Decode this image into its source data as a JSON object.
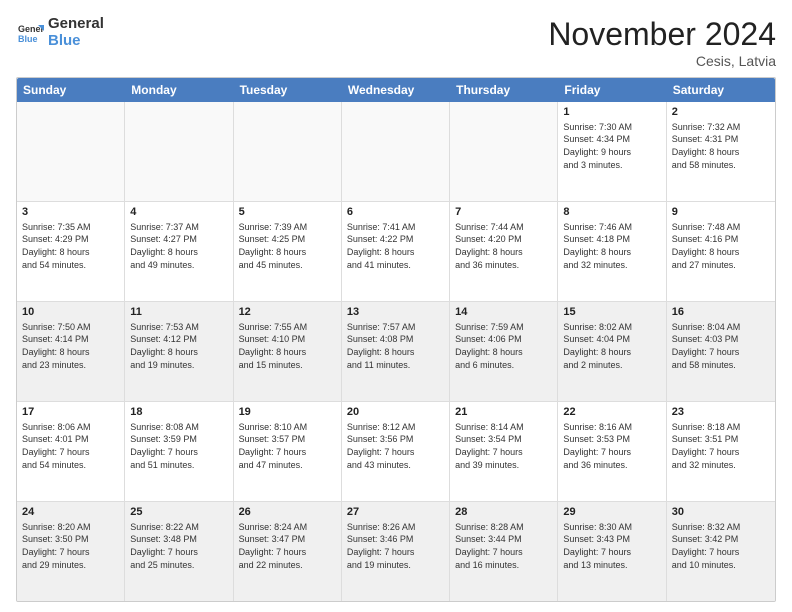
{
  "logo": {
    "line1": "General",
    "line2": "Blue"
  },
  "title": "November 2024",
  "location": "Cesis, Latvia",
  "days_of_week": [
    "Sunday",
    "Monday",
    "Tuesday",
    "Wednesday",
    "Thursday",
    "Friday",
    "Saturday"
  ],
  "weeks": [
    [
      {
        "day": "",
        "info": "",
        "shaded": true
      },
      {
        "day": "",
        "info": "",
        "shaded": true
      },
      {
        "day": "",
        "info": "",
        "shaded": true
      },
      {
        "day": "",
        "info": "",
        "shaded": true
      },
      {
        "day": "",
        "info": "",
        "shaded": true
      },
      {
        "day": "1",
        "info": "Sunrise: 7:30 AM\nSunset: 4:34 PM\nDaylight: 9 hours\nand 3 minutes.",
        "shaded": false
      },
      {
        "day": "2",
        "info": "Sunrise: 7:32 AM\nSunset: 4:31 PM\nDaylight: 8 hours\nand 58 minutes.",
        "shaded": false
      }
    ],
    [
      {
        "day": "3",
        "info": "Sunrise: 7:35 AM\nSunset: 4:29 PM\nDaylight: 8 hours\nand 54 minutes.",
        "shaded": false
      },
      {
        "day": "4",
        "info": "Sunrise: 7:37 AM\nSunset: 4:27 PM\nDaylight: 8 hours\nand 49 minutes.",
        "shaded": false
      },
      {
        "day": "5",
        "info": "Sunrise: 7:39 AM\nSunset: 4:25 PM\nDaylight: 8 hours\nand 45 minutes.",
        "shaded": false
      },
      {
        "day": "6",
        "info": "Sunrise: 7:41 AM\nSunset: 4:22 PM\nDaylight: 8 hours\nand 41 minutes.",
        "shaded": false
      },
      {
        "day": "7",
        "info": "Sunrise: 7:44 AM\nSunset: 4:20 PM\nDaylight: 8 hours\nand 36 minutes.",
        "shaded": false
      },
      {
        "day": "8",
        "info": "Sunrise: 7:46 AM\nSunset: 4:18 PM\nDaylight: 8 hours\nand 32 minutes.",
        "shaded": false
      },
      {
        "day": "9",
        "info": "Sunrise: 7:48 AM\nSunset: 4:16 PM\nDaylight: 8 hours\nand 27 minutes.",
        "shaded": false
      }
    ],
    [
      {
        "day": "10",
        "info": "Sunrise: 7:50 AM\nSunset: 4:14 PM\nDaylight: 8 hours\nand 23 minutes.",
        "shaded": true
      },
      {
        "day": "11",
        "info": "Sunrise: 7:53 AM\nSunset: 4:12 PM\nDaylight: 8 hours\nand 19 minutes.",
        "shaded": true
      },
      {
        "day": "12",
        "info": "Sunrise: 7:55 AM\nSunset: 4:10 PM\nDaylight: 8 hours\nand 15 minutes.",
        "shaded": true
      },
      {
        "day": "13",
        "info": "Sunrise: 7:57 AM\nSunset: 4:08 PM\nDaylight: 8 hours\nand 11 minutes.",
        "shaded": true
      },
      {
        "day": "14",
        "info": "Sunrise: 7:59 AM\nSunset: 4:06 PM\nDaylight: 8 hours\nand 6 minutes.",
        "shaded": true
      },
      {
        "day": "15",
        "info": "Sunrise: 8:02 AM\nSunset: 4:04 PM\nDaylight: 8 hours\nand 2 minutes.",
        "shaded": true
      },
      {
        "day": "16",
        "info": "Sunrise: 8:04 AM\nSunset: 4:03 PM\nDaylight: 7 hours\nand 58 minutes.",
        "shaded": true
      }
    ],
    [
      {
        "day": "17",
        "info": "Sunrise: 8:06 AM\nSunset: 4:01 PM\nDaylight: 7 hours\nand 54 minutes.",
        "shaded": false
      },
      {
        "day": "18",
        "info": "Sunrise: 8:08 AM\nSunset: 3:59 PM\nDaylight: 7 hours\nand 51 minutes.",
        "shaded": false
      },
      {
        "day": "19",
        "info": "Sunrise: 8:10 AM\nSunset: 3:57 PM\nDaylight: 7 hours\nand 47 minutes.",
        "shaded": false
      },
      {
        "day": "20",
        "info": "Sunrise: 8:12 AM\nSunset: 3:56 PM\nDaylight: 7 hours\nand 43 minutes.",
        "shaded": false
      },
      {
        "day": "21",
        "info": "Sunrise: 8:14 AM\nSunset: 3:54 PM\nDaylight: 7 hours\nand 39 minutes.",
        "shaded": false
      },
      {
        "day": "22",
        "info": "Sunrise: 8:16 AM\nSunset: 3:53 PM\nDaylight: 7 hours\nand 36 minutes.",
        "shaded": false
      },
      {
        "day": "23",
        "info": "Sunrise: 8:18 AM\nSunset: 3:51 PM\nDaylight: 7 hours\nand 32 minutes.",
        "shaded": false
      }
    ],
    [
      {
        "day": "24",
        "info": "Sunrise: 8:20 AM\nSunset: 3:50 PM\nDaylight: 7 hours\nand 29 minutes.",
        "shaded": true
      },
      {
        "day": "25",
        "info": "Sunrise: 8:22 AM\nSunset: 3:48 PM\nDaylight: 7 hours\nand 25 minutes.",
        "shaded": true
      },
      {
        "day": "26",
        "info": "Sunrise: 8:24 AM\nSunset: 3:47 PM\nDaylight: 7 hours\nand 22 minutes.",
        "shaded": true
      },
      {
        "day": "27",
        "info": "Sunrise: 8:26 AM\nSunset: 3:46 PM\nDaylight: 7 hours\nand 19 minutes.",
        "shaded": true
      },
      {
        "day": "28",
        "info": "Sunrise: 8:28 AM\nSunset: 3:44 PM\nDaylight: 7 hours\nand 16 minutes.",
        "shaded": true
      },
      {
        "day": "29",
        "info": "Sunrise: 8:30 AM\nSunset: 3:43 PM\nDaylight: 7 hours\nand 13 minutes.",
        "shaded": true
      },
      {
        "day": "30",
        "info": "Sunrise: 8:32 AM\nSunset: 3:42 PM\nDaylight: 7 hours\nand 10 minutes.",
        "shaded": true
      }
    ]
  ]
}
